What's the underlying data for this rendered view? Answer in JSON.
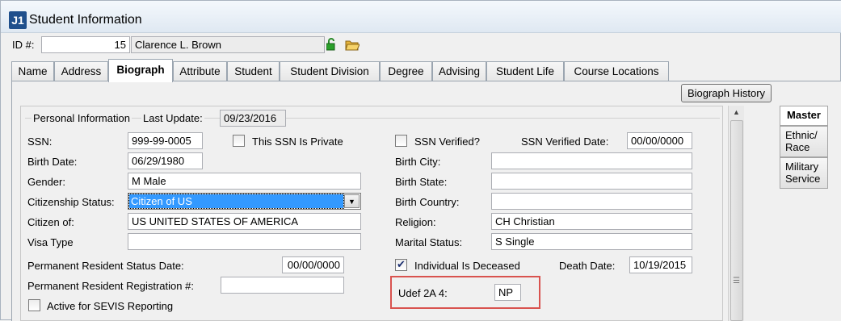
{
  "window": {
    "title": "Student Information",
    "icon_label": "J1"
  },
  "id_row": {
    "label": "ID #:",
    "id_value": "15",
    "name_value": "Clarence L. Brown"
  },
  "tabs": [
    {
      "label": "Name"
    },
    {
      "label": "Address"
    },
    {
      "label": "Biograph"
    },
    {
      "label": "Attribute"
    },
    {
      "label": "Student"
    },
    {
      "label": "Student Division"
    },
    {
      "label": "Degree"
    },
    {
      "label": "Advising"
    },
    {
      "label": "Student Life"
    },
    {
      "label": "Course Locations"
    }
  ],
  "active_tab": "Biograph",
  "history_button": "Biograph History",
  "group": {
    "title": "Personal Information",
    "last_update_label": "Last Update:",
    "last_update_value": "09/23/2016"
  },
  "left": {
    "ssn_label": "SSN:",
    "ssn_value": "999-99-0005",
    "ssn_private_label": "This SSN Is Private",
    "birth_date_label": "Birth Date:",
    "birth_date_value": "06/29/1980",
    "gender_label": "Gender:",
    "gender_value": "M  Male",
    "citizenship_label": "Citizenship Status:",
    "citizenship_value": "Citizen of US",
    "citizen_of_label": "Citizen of:",
    "citizen_of_value": "US  UNITED STATES OF AMERICA",
    "visa_label": "Visa Type",
    "visa_value": "",
    "perm_res_date_label": "Permanent Resident Status Date:",
    "perm_res_date_value": "00/00/0000",
    "perm_res_reg_label": "Permanent Resident Registration #:",
    "perm_res_reg_value": "",
    "sevis_label": "Active for SEVIS Reporting"
  },
  "right": {
    "ssn_verified_label": "SSN Verified?",
    "ssn_verified_date_label": "SSN Verified Date:",
    "ssn_verified_date_value": "00/00/0000",
    "birth_city_label": "Birth City:",
    "birth_city_value": "",
    "birth_state_label": "Birth State:",
    "birth_state_value": "",
    "birth_country_label": "Birth Country:",
    "birth_country_value": "",
    "religion_label": "Religion:",
    "religion_value": "CH  Christian",
    "marital_label": "Marital Status:",
    "marital_value": "S  Single",
    "deceased_label": "Individual Is Deceased",
    "deceased_checked": true,
    "death_date_label": "Death Date:",
    "death_date_value": "10/19/2015",
    "udef_label": "Udef 2A 4:",
    "udef_value": "NP"
  },
  "side_tabs": [
    {
      "label": "Master"
    },
    {
      "label": "Ethnic/ Race"
    },
    {
      "label": "Military Service"
    }
  ],
  "colors": {
    "highlight": "#d9534f",
    "selection": "#3399ff",
    "app_icon": "#1f4f8c"
  },
  "icons": {
    "lock": "unlock-icon",
    "folder": "open-folder-icon"
  }
}
